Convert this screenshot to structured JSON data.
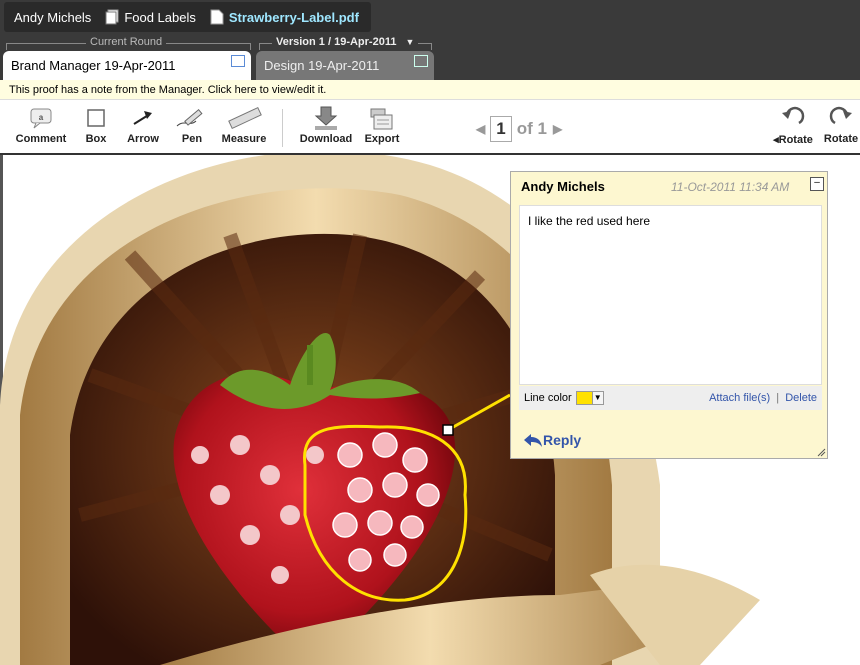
{
  "breadcrumb": {
    "user": "Andy Michels",
    "folder": "Food Labels",
    "file": "Strawberry-Label.pdf"
  },
  "rounds": {
    "current_label": "Current Round",
    "version_label": "Version 1 / 19-Apr-2011"
  },
  "tabs": [
    {
      "label": "Brand Manager 19-Apr-2011"
    },
    {
      "label": "Design 19-Apr-2011"
    }
  ],
  "notebar": {
    "text": "This proof has a note from the Manager. Click here to view/edit it."
  },
  "tools": {
    "comment": "Comment",
    "box": "Box",
    "arrow": "Arrow",
    "pen": "Pen",
    "measure": "Measure",
    "download": "Download",
    "export": "Export",
    "rotate_left": "Rotate",
    "rotate_right": "Rotate"
  },
  "pager": {
    "current": "1",
    "of_text": "of 1"
  },
  "note": {
    "author": "Andy Michels",
    "date": "11-Oct-2011 11:34 AM",
    "text": "I like the red used here",
    "line_color_label": "Line color",
    "attach_label": "Attach file(s)",
    "delete_label": "Delete",
    "reply_label": "Reply",
    "line_color": "#ffe100"
  }
}
